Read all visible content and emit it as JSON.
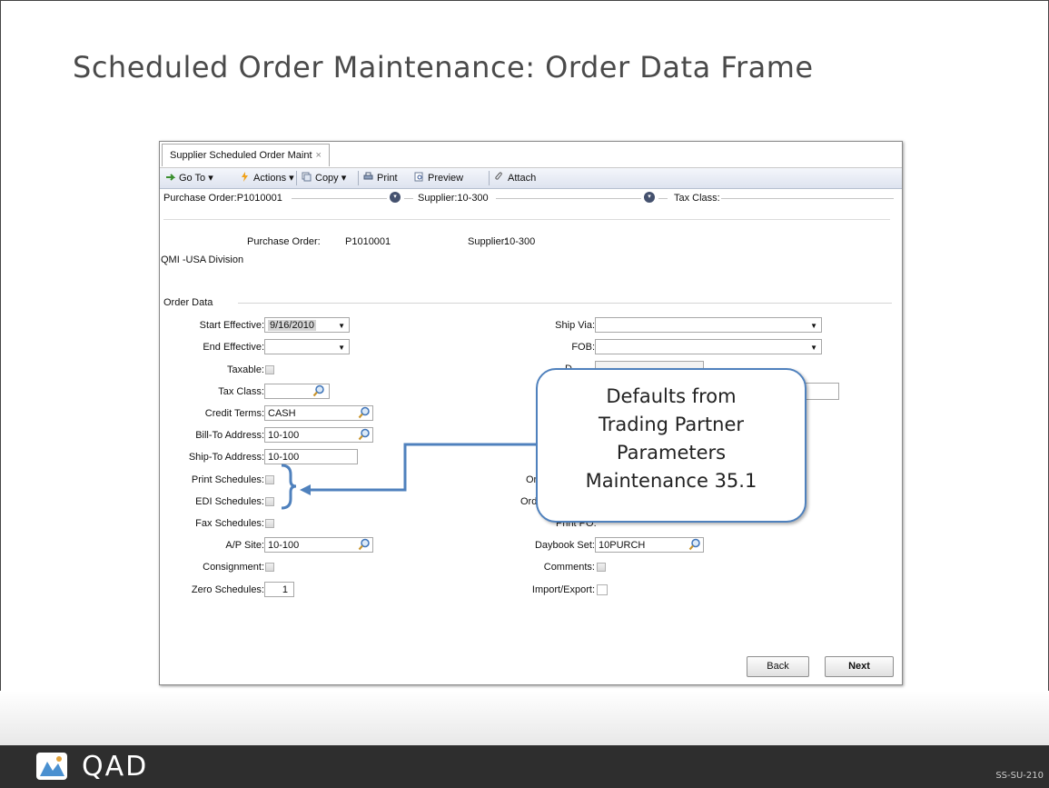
{
  "slide": {
    "title": "Scheduled Order Maintenance: Order Data Frame",
    "brand": "QAD",
    "code": "SS-SU-210"
  },
  "app": {
    "tab_label": "Supplier Scheduled Order Maint",
    "tab_close": "×",
    "toolbar": {
      "goto": "Go To",
      "actions": "Actions",
      "copy": "Copy",
      "print": "Print",
      "preview": "Preview",
      "attach": "Attach",
      "dropdown_glyph": "▾"
    },
    "header": {
      "po": "Purchase Order:P1010001",
      "supplier": "Supplier:10-300",
      "taxclass": "Tax Class:"
    },
    "info": {
      "po_label": "Purchase Order:",
      "po_value": "P1010001",
      "supplier_label": "Supplier:",
      "supplier_value": "10-300",
      "division": "QMI -USA Division"
    },
    "section": "Order Data",
    "left": {
      "start_effective_label": "Start Effective:",
      "start_effective_value": "9/16/2010",
      "end_effective_label": "End Effective:",
      "end_effective_value": "",
      "taxable_label": "Taxable:",
      "tax_class_label": "Tax Class:",
      "tax_class_value": "",
      "credit_terms_label": "Credit Terms:",
      "credit_terms_value": "CASH",
      "bill_to_label": "Bill-To Address:",
      "bill_to_value": "10-100",
      "ship_to_label": "Ship-To Address:",
      "ship_to_value": "10-100",
      "print_schedules_label": "Print Schedules:",
      "edi_schedules_label": "EDI Schedules:",
      "fax_schedules_label": "Fax Schedules:",
      "ap_site_label": "A/P Site:",
      "ap_site_value": "10-100",
      "consignment_label": "Consignment:",
      "zero_schedules_label": "Zero Schedules:",
      "zero_schedules_value": "1"
    },
    "right": {
      "ship_via_label": "Ship Via:",
      "ship_via_value": "",
      "fob_label": "FOB:",
      "fob_value": "",
      "partial_d": "D",
      "partial_or1": "Or",
      "partial_or2": "Ord",
      "partial_print": "Print PO:",
      "daybook_label": "Daybook Set:",
      "daybook_value": "10PURCH",
      "comments_label": "Comments:",
      "import_export_label": "Import/Export:"
    },
    "buttons": {
      "back": "Back",
      "next": "Next"
    }
  },
  "callout": {
    "line1": "Defaults from",
    "line2": "Trading Partner",
    "line3": "Parameters",
    "line4": "Maintenance 35.1"
  },
  "colors": {
    "callout_border": "#4f81bd",
    "footer_bg": "#2e2e2e",
    "header_circle": "#44516e"
  }
}
